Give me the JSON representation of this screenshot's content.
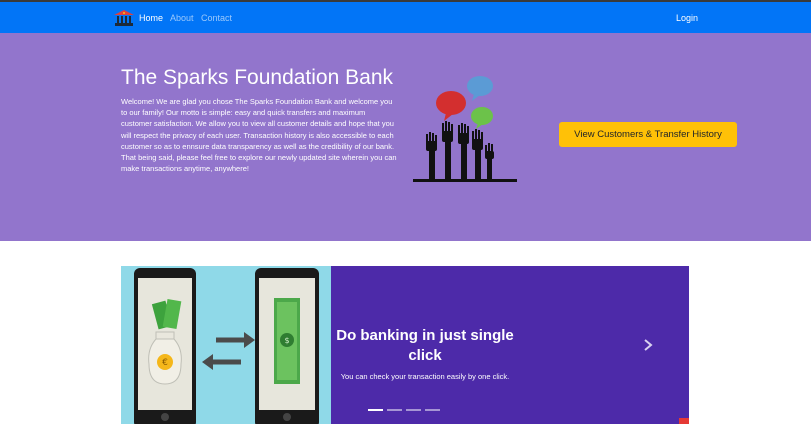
{
  "nav": {
    "logo_icon": "bank-building-icon",
    "links": [
      "Home",
      "About",
      "Contact"
    ],
    "login": "Login"
  },
  "hero": {
    "title": "The Sparks Foundation Bank",
    "text": "Welcome! We are glad you chose The Sparks Foundation Bank and welcome you to our family! Our motto is simple: easy and quick transfers and maximum customer satisfaction. We allow you to view all customer details and hope that you will respect the privacy of each user. Transaction history is also accessible to each customer so as to ennsure data transparency as well as the credibility of our bank. That being said, please feel free to explore our newly updated site wherein you can make transactions anytime, anywhere!",
    "button": "View Customers & Transfer History",
    "illustration": "raised-hands-speech-bubbles-icon"
  },
  "carousel": {
    "heading": "Do banking in just single click",
    "caption": "You can check your transaction easily by one click.",
    "slide_count": 4,
    "active_index": 0,
    "next_icon": "chevron-right-icon"
  },
  "colors": {
    "navbar": "#0275f7",
    "hero": "#9275cc",
    "button": "#ffc107",
    "carousel": "#4d2aa9",
    "slide_image_bg": "#8fd9e8"
  }
}
